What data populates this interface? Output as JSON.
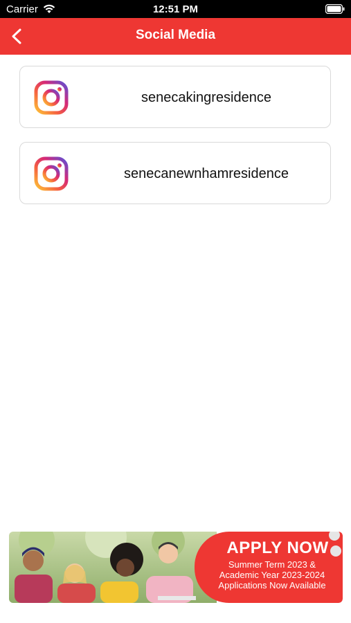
{
  "status_bar": {
    "carrier": "Carrier",
    "time": "12:51 PM"
  },
  "nav": {
    "title": "Social Media"
  },
  "social_links": [
    {
      "platform": "instagram-icon",
      "handle": "senecakingresidence"
    },
    {
      "platform": "instagram-icon",
      "handle": "senecanewnhamresidence"
    }
  ],
  "banner": {
    "headline": "APPLY NOW",
    "line1": "Summer Term 2023 &",
    "line2": "Academic Year 2023-2024",
    "line3": "Applications Now Available"
  },
  "colors": {
    "accent": "#ee3733",
    "card_border": "#d9d9d9"
  }
}
